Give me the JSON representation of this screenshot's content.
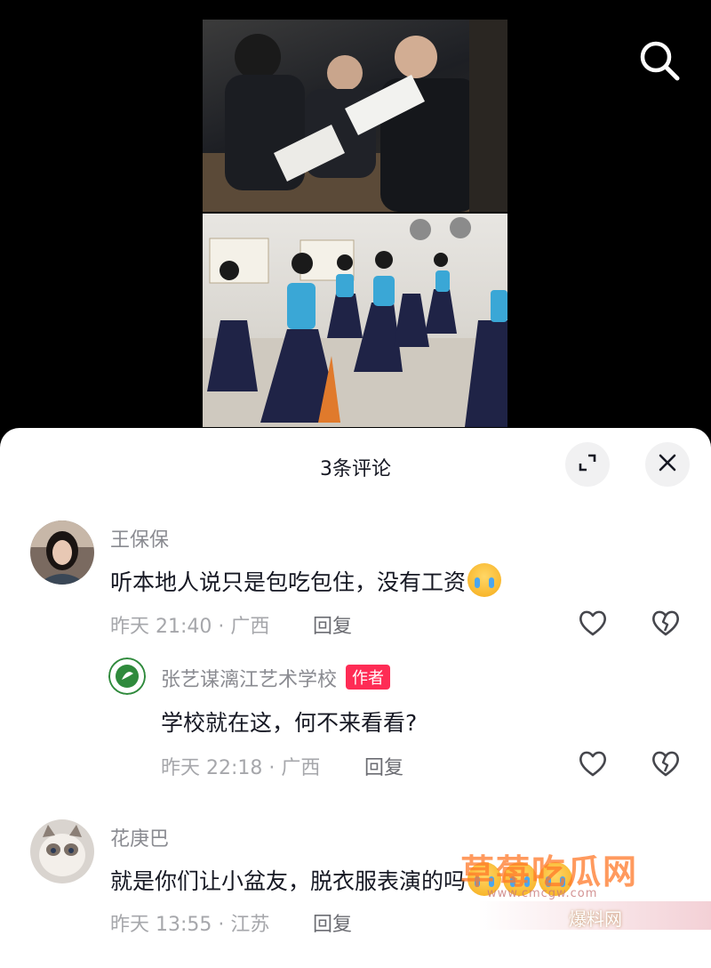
{
  "header": {
    "search_icon": "search-icon"
  },
  "panel": {
    "title": "3条评论",
    "expand_icon": "expand-icon",
    "close_icon": "close-icon"
  },
  "comments": [
    {
      "user": "王保保",
      "text": "听本地人说只是包吃包住，没有工资",
      "emoji": "crying-emoji",
      "time": "昨天 21:40 · 广西",
      "reply_label": "回复",
      "reply": {
        "user": "张艺谋漓江艺术学校",
        "badge": "作者",
        "text": "学校就在这，何不来看看?",
        "time": "昨天 22:18 · 广西",
        "reply_label": "回复"
      }
    },
    {
      "user": "花庚巴",
      "text": "就是你们让小盆友，脱衣服表演的吗",
      "emoji": "crying-emoji",
      "time": "昨天 13:55 · 江苏",
      "reply_label": "回复"
    }
  ],
  "watermark": {
    "main": "草莓吃瓜网",
    "url": "www.cmcgw.com",
    "secondary": "爆料网"
  },
  "colors": {
    "accent": "#fe2c55",
    "sheet_bg": "#ffffff"
  }
}
